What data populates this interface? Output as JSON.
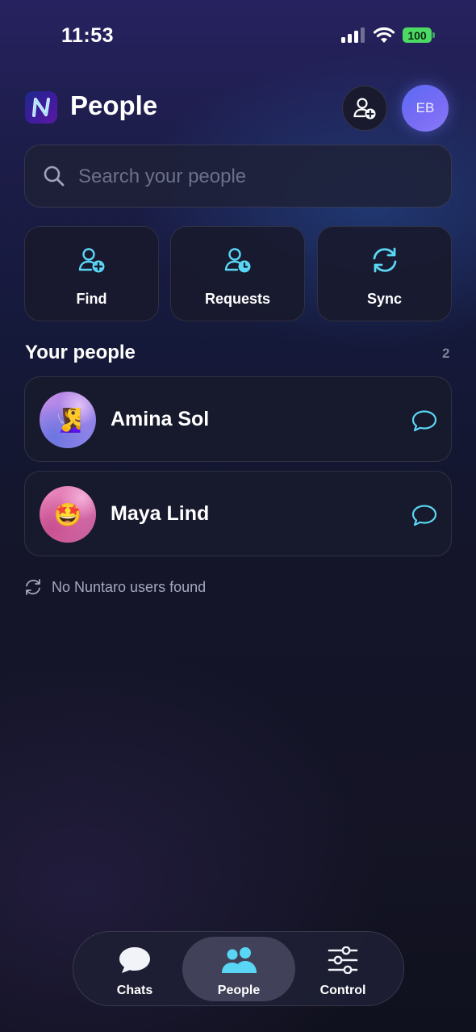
{
  "status_bar": {
    "time": "11:53",
    "battery": "100"
  },
  "header": {
    "title": "People",
    "avatar_initials": "EB"
  },
  "search": {
    "placeholder": "Search your people"
  },
  "actions": [
    {
      "label": "Find",
      "icon": "user-plus-icon"
    },
    {
      "label": "Requests",
      "icon": "user-clock-icon"
    },
    {
      "label": "Sync",
      "icon": "sync-icon"
    }
  ],
  "section": {
    "title": "Your people",
    "count": "2"
  },
  "people": [
    {
      "name": "Amina Sol",
      "avatar_emoji": "🧏‍♀️"
    },
    {
      "name": "Maya Lind",
      "avatar_emoji": "🤩"
    }
  ],
  "sync_status": "No Nuntaro users found",
  "tabs": [
    {
      "label": "Chats",
      "icon": "chat-bubble-icon",
      "active": false
    },
    {
      "label": "People",
      "icon": "people-icon",
      "active": true
    },
    {
      "label": "Control",
      "icon": "sliders-icon",
      "active": false
    }
  ],
  "colors": {
    "accent": "#5ad6f5",
    "background": "#141529",
    "avatar": "#6b6cf5",
    "battery": "#4cd964"
  }
}
